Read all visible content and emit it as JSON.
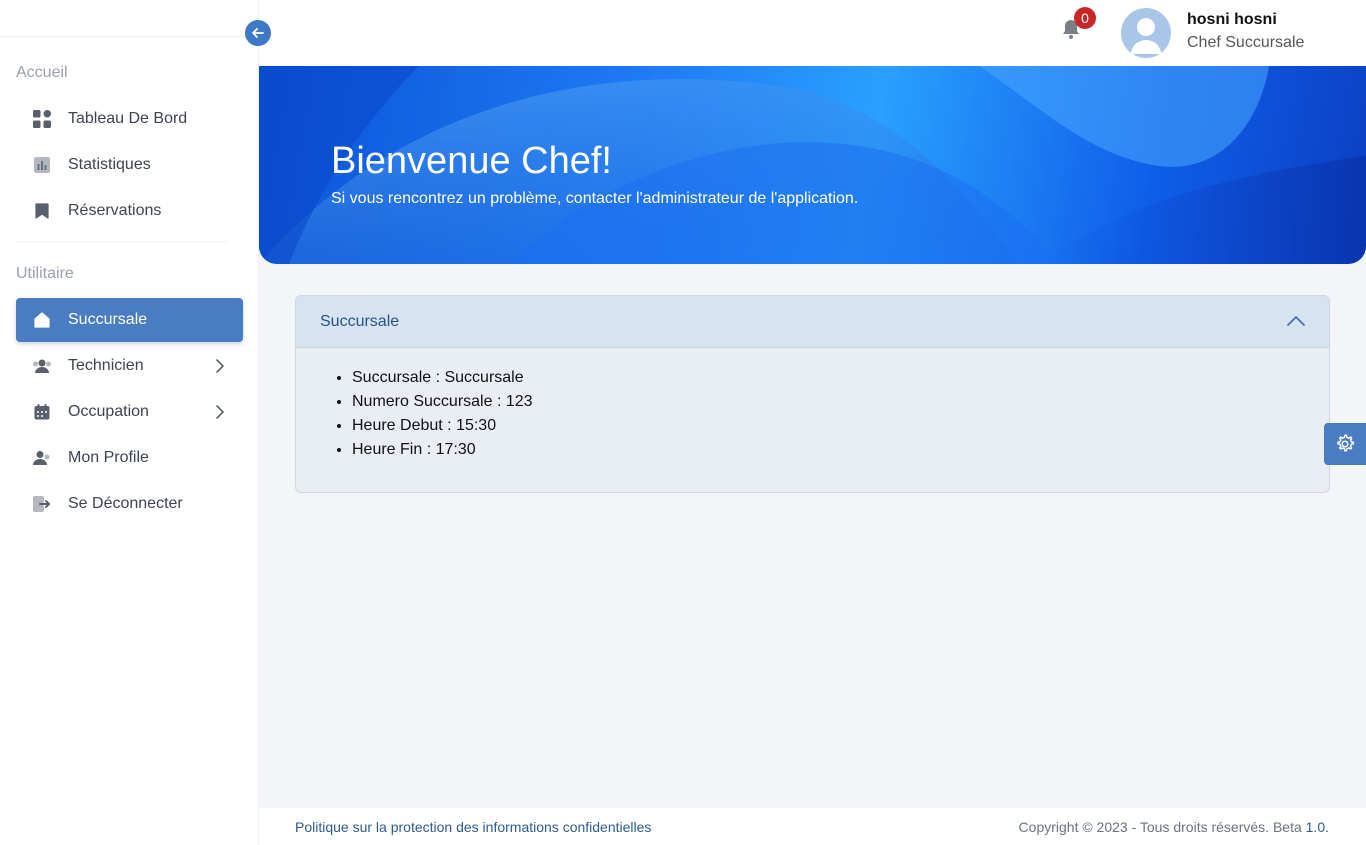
{
  "sidebar": {
    "sections": [
      {
        "label": "Accueil"
      },
      {
        "label": "Utilitaire"
      }
    ],
    "items": [
      {
        "label": "Tableau De Bord",
        "icon": "dashboard-icon"
      },
      {
        "label": "Statistiques",
        "icon": "chart-icon"
      },
      {
        "label": "Réservations",
        "icon": "bookmark-icon"
      },
      {
        "label": "Succursale",
        "icon": "home-icon",
        "active": true
      },
      {
        "label": "Technicien",
        "icon": "users-icon",
        "has_submenu": true
      },
      {
        "label": "Occupation",
        "icon": "calendar-icon",
        "has_submenu": true
      },
      {
        "label": "Mon Profile",
        "icon": "user-icon"
      },
      {
        "label": "Se Déconnecter",
        "icon": "logout-icon"
      }
    ]
  },
  "header": {
    "notifications_count": "0",
    "user_name": "hosni hosni",
    "user_role": "Chef Succursale"
  },
  "banner": {
    "title": "Bienvenue Chef!",
    "subtitle": "Si vous rencontrez un problème, contacter l'administrateur de l'application."
  },
  "card": {
    "title": "Succursale",
    "details": [
      "Succursale : Succursale",
      "Numero Succursale : 123",
      "Heure Debut : 15:30",
      "Heure Fin : 17:30"
    ]
  },
  "footer": {
    "privacy_link": "Politique sur la protection des informations confidentielles",
    "copyright": "Copyright © 2023 - Tous droits réservés. Beta ",
    "version": "1.0."
  },
  "colors": {
    "accent": "#4a7cc3",
    "badge": "#c62828",
    "banner": "#1f7cf5"
  }
}
